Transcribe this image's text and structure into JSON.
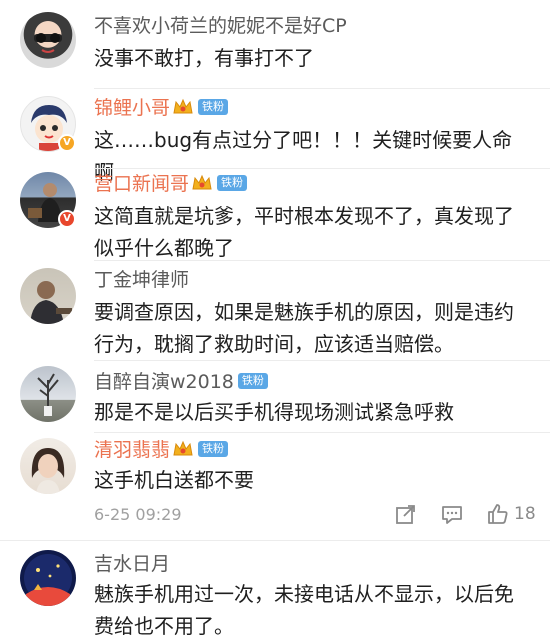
{
  "comments": [
    {
      "name": "不喜欢小荷兰的妮妮不是好CP",
      "text": "没事不敢打，有事打不了",
      "vip": false,
      "fan_badge": ""
    },
    {
      "name": "锦鲤小哥",
      "text": "这……bug有点过分了吧！！！关键时候要人命啊",
      "vip": true,
      "fan_badge": "铁粉",
      "verified": "V"
    },
    {
      "name": "营口新闻哥",
      "text": "这简直就是坑爹，平时根本发现不了，真发现了似乎什么都晚了",
      "vip": true,
      "fan_badge": "铁粉",
      "verified": "V"
    },
    {
      "name": "丁金坤律师",
      "text": "要调查原因，如果是魅族手机的原因，则是违约行为，耽搁了救助时间，应该适当赔偿。",
      "vip": false,
      "fan_badge": ""
    },
    {
      "name": "自醉自演w2018",
      "text": "那是不是以后买手机得现场测试紧急呼救",
      "vip": false,
      "fan_badge": "铁粉"
    },
    {
      "name": "清羽翡翡",
      "text": "这手机白送都不要",
      "vip": true,
      "fan_badge": "铁粉"
    },
    {
      "name": "吉水日月",
      "text": "魅族手机用过一次，未接电话从不显示，以后免费给也不用了。",
      "vip": false,
      "fan_badge": ""
    }
  ],
  "meta": {
    "timestamp": "6-25 09:29",
    "like_count": "18"
  },
  "colors": {
    "vip_name": "#eb7350",
    "plain_name": "#5b5b5b",
    "fan_badge": "#5aa7e6",
    "verified_gold": "#f6a623",
    "verified_red": "#e8462c"
  }
}
